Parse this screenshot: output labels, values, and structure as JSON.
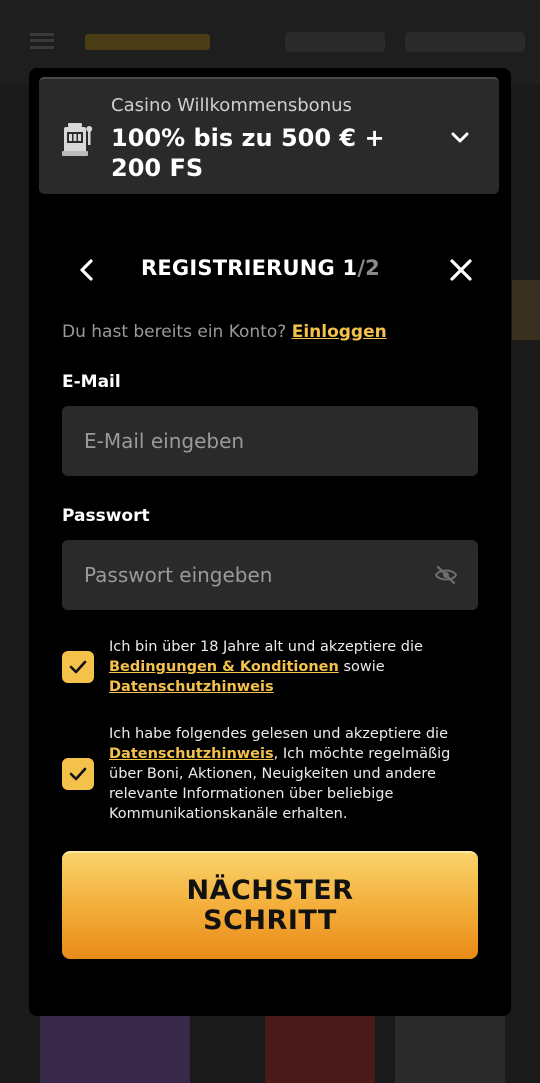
{
  "bonus": {
    "subtitle": "Casino Willkommensbonus",
    "title": "100% bis zu 500 € + 200 FS"
  },
  "registration": {
    "title_main": "REGISTRIERUNG 1",
    "title_total": "/2"
  },
  "login": {
    "prompt": "Du hast bereits ein Konto?",
    "link": "Einloggen"
  },
  "email": {
    "label": "E-Mail",
    "placeholder": "E-Mail eingeben"
  },
  "password": {
    "label": "Passwort",
    "placeholder": "Passwort eingeben"
  },
  "consent1": {
    "checked": true,
    "text_before": "Ich bin über 18 Jahre alt und akzeptiere die",
    "link1": "Bedingungen & Konditionen",
    "text_mid": "sowie",
    "link2": "Datenschutzhinweis"
  },
  "consent2": {
    "checked": true,
    "text_before": "Ich habe folgendes gelesen und akzeptiere die",
    "link": "Datenschutzhinweis",
    "text_after": ", Ich möchte regelmäßig über Boni, Aktionen, Neuigkeiten und andere relevante Informationen über beliebige Kommunikationskanäle erhalten."
  },
  "cta": {
    "label": "NÄCHSTER SCHRITT"
  },
  "colors": {
    "accent": "#f4c24a",
    "modal_bg": "#000000",
    "field_bg": "#2a2a2a"
  }
}
